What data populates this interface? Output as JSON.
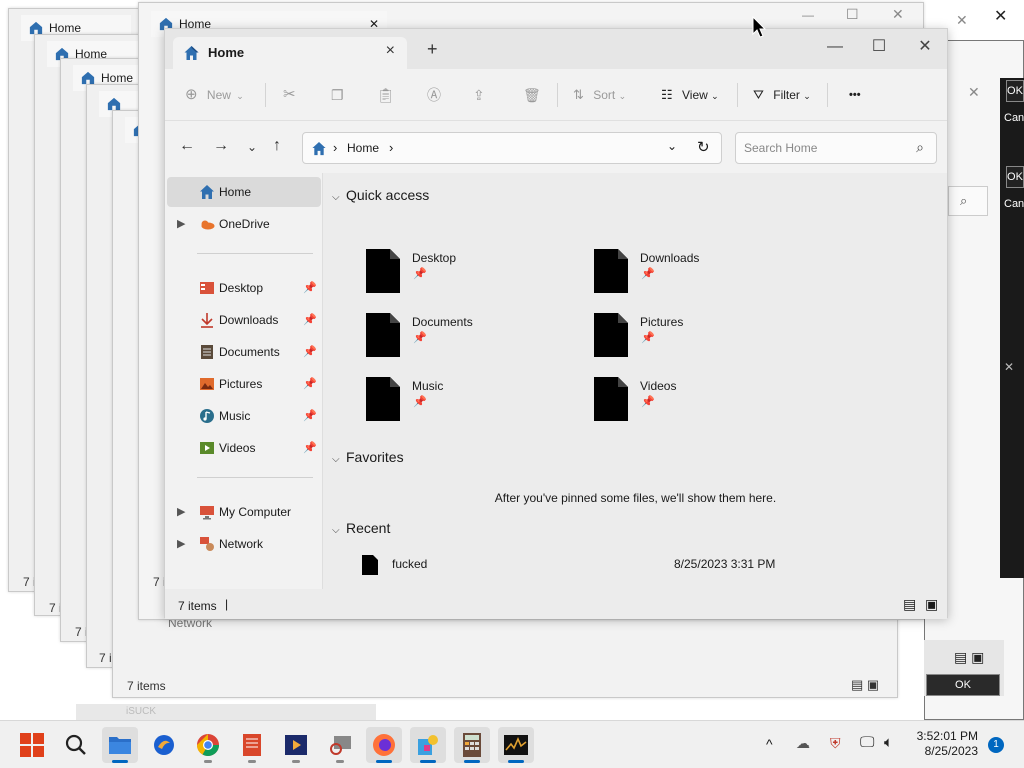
{
  "window": {
    "tab_title": "Home",
    "close_tab": "×",
    "new_tab": "+",
    "controls": {
      "minimize": "—",
      "maximize": "☐",
      "close": "✕"
    }
  },
  "toolbar": {
    "new_label": "New",
    "sort_label": "Sort",
    "view_label": "View",
    "filter_label": "Filter",
    "more_label": "•••"
  },
  "address": {
    "crumb": "Home",
    "sep": "›",
    "search_placeholder": "Search Home"
  },
  "sidebar": {
    "top": [
      {
        "label": "Home",
        "icon": "home-icon",
        "selected": true
      },
      {
        "label": "OneDrive",
        "icon": "onedrive-icon",
        "expandable": true
      }
    ],
    "pinned": [
      {
        "label": "Desktop",
        "icon": "desktop-folder-icon",
        "color": "#d9523a"
      },
      {
        "label": "Downloads",
        "icon": "download-icon",
        "color": "#c0392b"
      },
      {
        "label": "Documents",
        "icon": "documents-icon",
        "color": "#5a4a3a"
      },
      {
        "label": "Pictures",
        "icon": "pictures-icon",
        "color": "#e06a2c"
      },
      {
        "label": "Music",
        "icon": "music-icon",
        "color": "#2a6e8c"
      },
      {
        "label": "Videos",
        "icon": "videos-icon",
        "color": "#5a8a2a"
      }
    ],
    "pin_glyph": "📌",
    "bottom": [
      {
        "label": "My Computer",
        "icon": "computer-icon"
      },
      {
        "label": "Network",
        "icon": "network-icon"
      }
    ]
  },
  "content": {
    "quick_access_title": "Quick access",
    "quick_access": [
      {
        "name": "Desktop"
      },
      {
        "name": "Downloads"
      },
      {
        "name": "Documents"
      },
      {
        "name": "Pictures"
      },
      {
        "name": "Music"
      },
      {
        "name": "Videos"
      }
    ],
    "favorites_title": "Favorites",
    "favorites_empty": "After you've pinned some files, we'll show them here.",
    "recent_title": "Recent",
    "recent": [
      {
        "name": "fucked",
        "modified": "8/25/2023 3:31 PM"
      }
    ]
  },
  "status": {
    "items": "7 items"
  },
  "ghost": {
    "tab_title": "Home",
    "items": "7 i",
    "items_full": "7 items",
    "network": "Network",
    "blurred_task": "iSUCK"
  },
  "dialog": {
    "ok": "OK",
    "ok_short": "OK",
    "cancel_short": "Can"
  },
  "taskbar": {
    "time": "3:52:01 PM",
    "date": "8/25/2023",
    "notifications": "1",
    "chevron": "^"
  }
}
